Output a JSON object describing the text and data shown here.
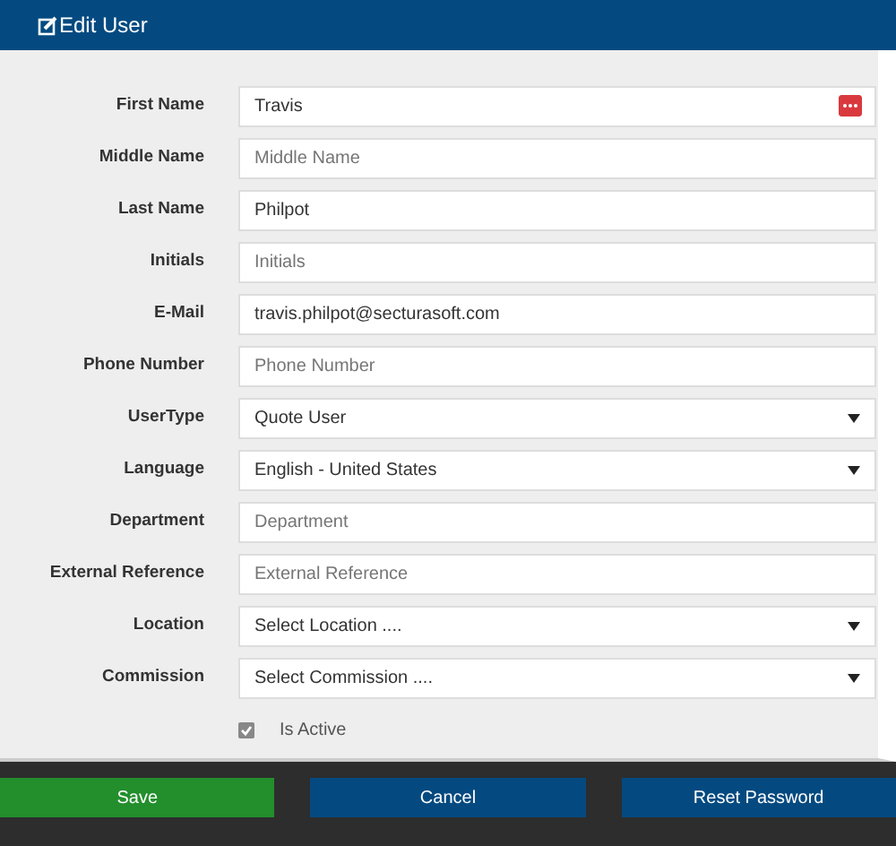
{
  "window": {
    "title": "Edit User"
  },
  "fields": [
    {
      "label": "First Name",
      "kind": "text",
      "value": "Travis",
      "autofill_icon": true
    },
    {
      "label": "Middle Name",
      "kind": "text",
      "placeholder": "Middle Name"
    },
    {
      "label": "Last Name",
      "kind": "text",
      "value": "Philpot"
    },
    {
      "label": "Initials",
      "kind": "text",
      "placeholder": "Initials"
    },
    {
      "label": "E-Mail",
      "kind": "text",
      "value": "travis.philpot@secturasoft.com"
    },
    {
      "label": "Phone Number",
      "kind": "text",
      "placeholder": "Phone Number"
    },
    {
      "label": "UserType",
      "kind": "select",
      "value": "Quote User"
    },
    {
      "label": "Language",
      "kind": "select",
      "value": "English - United States"
    },
    {
      "label": "Department",
      "kind": "text",
      "placeholder": "Department"
    },
    {
      "label": "External Reference",
      "kind": "text",
      "placeholder": "External Reference"
    },
    {
      "label": "Location",
      "kind": "select",
      "value": "Select Location ...."
    },
    {
      "label": "Commission",
      "kind": "select",
      "value": "Select Commission ...."
    }
  ],
  "is_active": {
    "label": "Is Active",
    "checked": true
  },
  "buttons": [
    {
      "label": "Save",
      "kind": "success"
    },
    {
      "label": "Cancel",
      "kind": "primary"
    },
    {
      "label": "Reset Password",
      "kind": "primary"
    }
  ]
}
